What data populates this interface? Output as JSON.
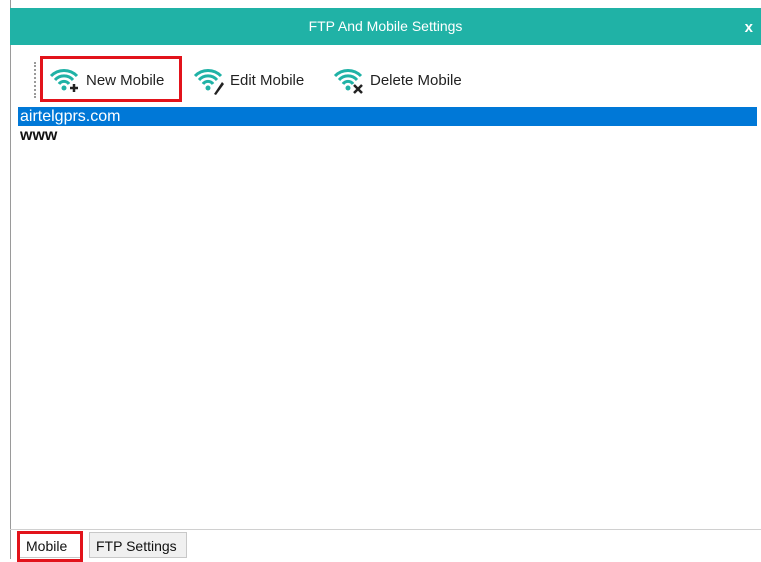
{
  "window": {
    "title": "FTP And Mobile Settings",
    "close_label": "x"
  },
  "toolbar": {
    "new_label": "New Mobile",
    "edit_label": "Edit Mobile",
    "delete_label": "Delete Mobile"
  },
  "list": {
    "items": [
      {
        "label": "airtelgprs.com",
        "selected": true
      },
      {
        "label": "www",
        "selected": false
      }
    ]
  },
  "tabs": [
    {
      "label": "Mobile",
      "active": true
    },
    {
      "label": "FTP Settings",
      "active": false
    }
  ],
  "colors": {
    "titlebar": "#20b2a6",
    "selection": "#0078d7",
    "highlight": "#e2131b",
    "icon": "#20b2a6"
  }
}
